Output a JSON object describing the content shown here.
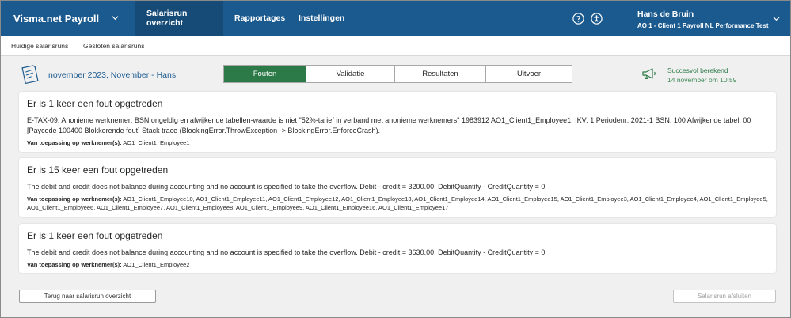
{
  "app": {
    "brand": "Visma.net Payroll",
    "nav": [
      {
        "label": "Salarisrun overzicht",
        "active": true
      },
      {
        "label": "Rapportages",
        "active": false
      },
      {
        "label": "Instellingen",
        "active": false
      }
    ],
    "user": {
      "name": "Hans de Bruin",
      "org": "AO 1 - Client 1 Payroll NL Performance Test"
    }
  },
  "subnav": {
    "items": [
      "Huidige salarisruns",
      "Gesloten salarisruns"
    ]
  },
  "run": {
    "title": "november 2023, November - Hans",
    "tabs": [
      {
        "label": "Fouten",
        "active": true
      },
      {
        "label": "Validatie",
        "active": false
      },
      {
        "label": "Resultaten",
        "active": false
      },
      {
        "label": "Uitvoer",
        "active": false
      }
    ],
    "status": {
      "label": "Succesvol berekend",
      "date": "14 november om 10:59"
    }
  },
  "errors": [
    {
      "title": "Er is 1 keer een fout opgetreden",
      "message": "E-TAX-09: Anonieme werknemer: BSN ongeldig en afwijkende tabellen-waarde is niet \"52%-tarief in verband met anonieme werknemers\" 1983912 AO1_Client1_Employee1, IKV: 1 Periodenr: 2021-1 BSN: 100 Afwijkende tabel: 00 [Paycode 100400 Blokkerende fout] Stack trace (BlockingError.ThrowException -> BlockingError.EnforceCrash).",
      "affected_label": "Van toepassing op werknemer(s):",
      "affected": "AO1_Client1_Employee1"
    },
    {
      "title": "Er is 15 keer een fout opgetreden",
      "message": "The debit and credit does not balance during accounting and no account is specified to take the overflow. Debit - credit = 3200.00, DebitQuantity - CreditQuantity = 0",
      "affected_label": "Van toepassing op werknemer(s):",
      "affected": "AO1_Client1_Employee10, AO1_Client1_Employee11, AO1_Client1_Employee12, AO1_Client1_Employee13, AO1_Client1_Employee14, AO1_Client1_Employee15, AO1_Client1_Employee3, AO1_Client1_Employee4, AO1_Client1_Employee5, AO1_Client1_Employee6, AO1_Client1_Employee7, AO1_Client1_Employee8, AO1_Client1_Employee9, AO1_Client1_Employee16, AO1_Client1_Employee17"
    },
    {
      "title": "Er is 1 keer een fout opgetreden",
      "message": "The debit and credit does not balance during accounting and no account is specified to take the overflow. Debit - credit = 3630.00, DebitQuantity - CreditQuantity = 0",
      "affected_label": "Van toepassing op werknemer(s):",
      "affected": "AO1_Client1_Employee2"
    }
  ],
  "footer": {
    "back_label": "Terug naar salarisrun overzicht",
    "close_label": "Salarisrun afsluiten"
  },
  "icons": {
    "help": "help-circle-icon",
    "accessibility": "accessibility-icon",
    "run": "payslip-icon",
    "status": "megaphone-icon"
  },
  "colors": {
    "topbar": "#1b5a8f",
    "active_nav": "#164b78",
    "active_tab": "#2b7a47",
    "status_text": "#2b7a47",
    "run_title": "#1b5a8f"
  }
}
